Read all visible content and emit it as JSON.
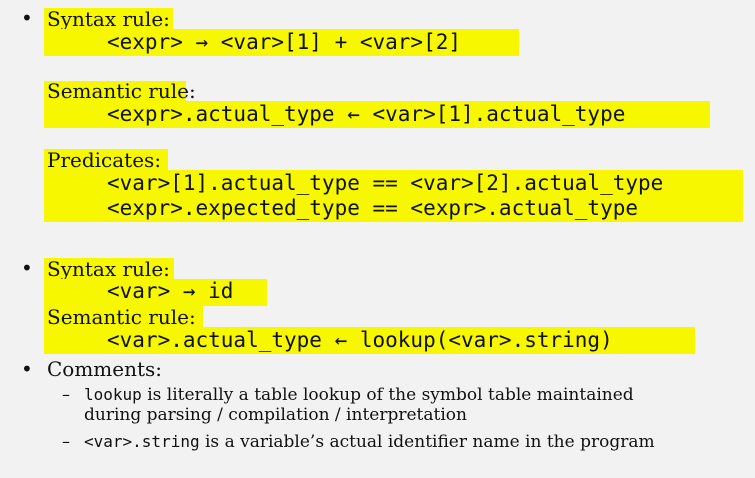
{
  "section1": {
    "bullet": "•",
    "syntax_label": "Syntax rule:",
    "syntax_code": "<expr> → <var>[1] + <var>[2]",
    "semantic_label": "Semantic rule:",
    "semantic_code": "<expr>.actual_type ← <var>[1].actual_type",
    "predicates_label": "Predicates:",
    "predicate_1": "<var>[1].actual_type == <var>[2].actual_type",
    "predicate_2": "<expr>.expected_type == <expr>.actual_type"
  },
  "section2": {
    "bullet": "•",
    "syntax_label": "Syntax rule:",
    "syntax_code": "<var> → id",
    "semantic_label": "Semantic rule:",
    "semantic_code": "<var>.actual_type ← lookup(<var>.string)"
  },
  "comments": {
    "bullet": "•",
    "label": "Comments:",
    "items": [
      {
        "dash": "–",
        "code": "lookup",
        "text_line1": " is literally a table lookup of the symbol table maintained",
        "text_line2": "during parsing / compilation / interpretation"
      },
      {
        "dash": "–",
        "code": "<var>.string",
        "text_line1": " is a variable’s actual identifier name in the program"
      }
    ]
  },
  "colors": {
    "background": "#f2f2f2",
    "highlight": "#f7f700",
    "text": "#111111"
  }
}
